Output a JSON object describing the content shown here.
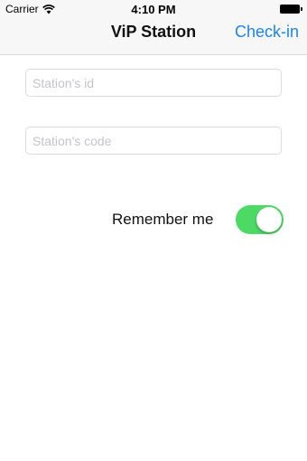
{
  "status_bar": {
    "carrier": "Carrier",
    "time": "4:10 PM",
    "wifi_icon": "wifi-icon",
    "battery_icon": "battery-icon"
  },
  "nav_bar": {
    "title": "ViP Station",
    "action_label": "Check-in"
  },
  "form": {
    "station_id": {
      "value": "",
      "placeholder": "Station's id"
    },
    "station_code": {
      "value": "",
      "placeholder": "Station's code"
    },
    "remember_label": "Remember me",
    "remember_on": true
  },
  "colors": {
    "accent": "#1a84f0",
    "toggle_on": "#4cd964",
    "nav_background": "#f7f7f7"
  }
}
